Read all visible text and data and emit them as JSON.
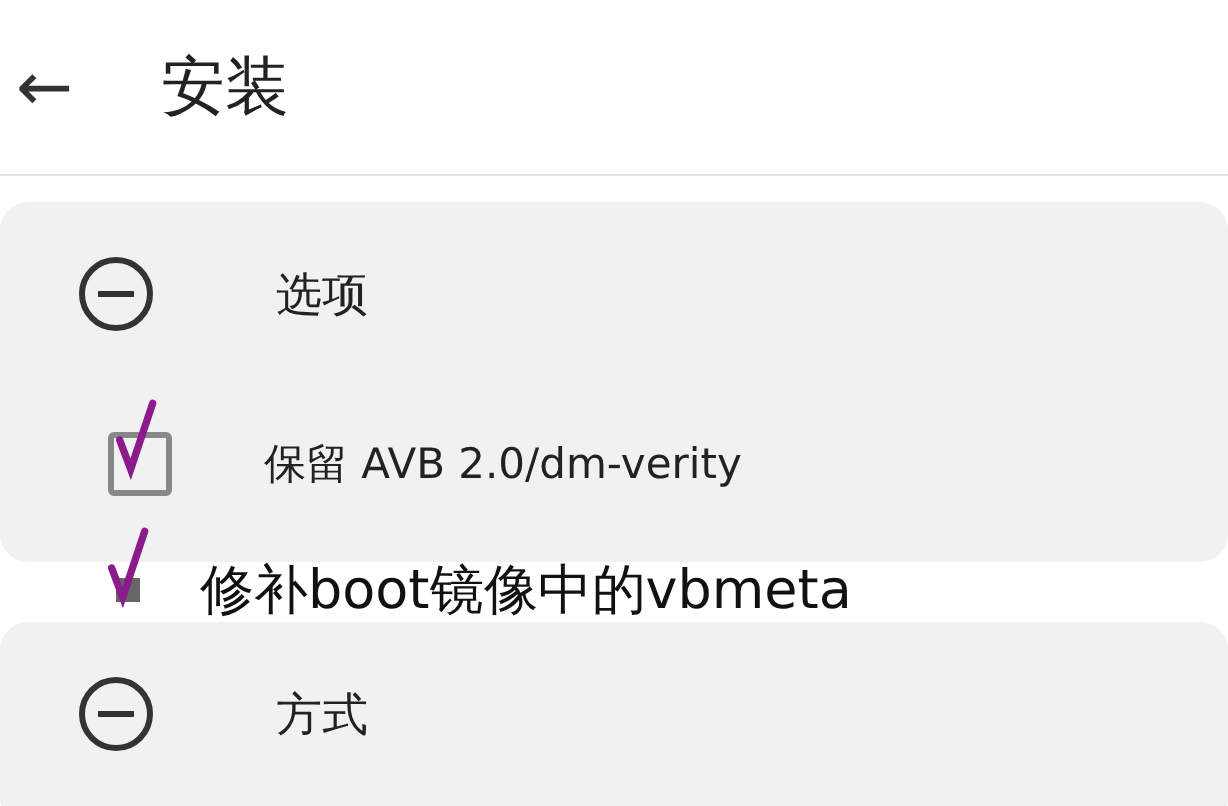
{
  "header": {
    "back": "←",
    "title": "安装"
  },
  "sections": [
    {
      "title": "选项",
      "expanded": true,
      "options": [
        {
          "label": "保留 AVB 2.0/dm-verity",
          "checked": true
        }
      ]
    },
    {
      "annotation": {
        "label": "修补boot镜像中的vbmeta",
        "checked": true
      }
    },
    {
      "title": "方式",
      "expanded": true
    }
  ]
}
